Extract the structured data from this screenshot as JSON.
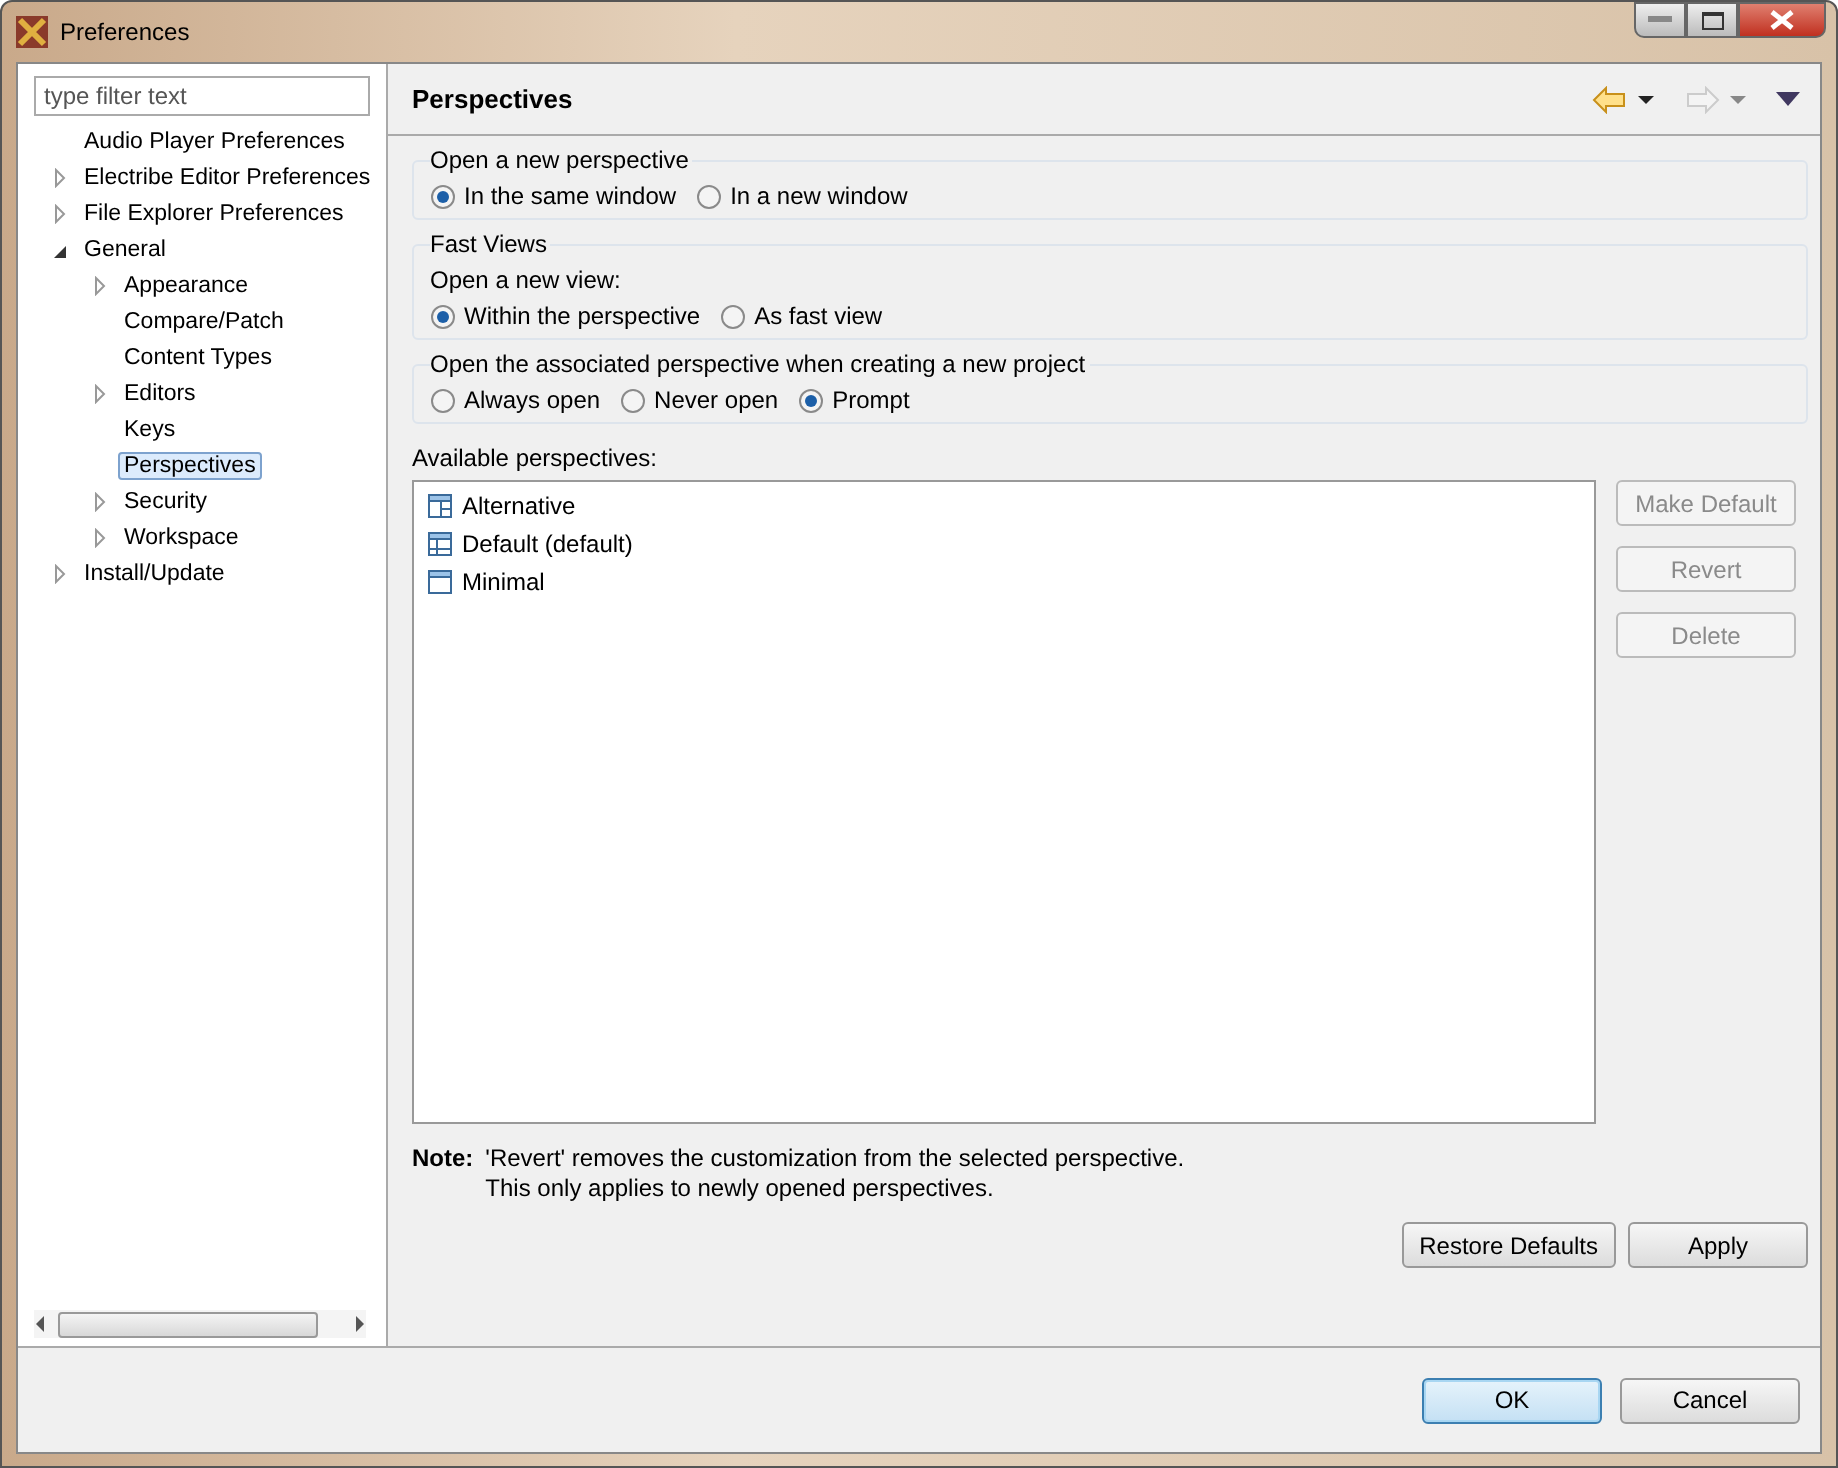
{
  "window": {
    "title": "Preferences"
  },
  "filter": {
    "placeholder": "type filter text"
  },
  "tree": [
    {
      "label": "Audio Player Preferences",
      "kind": "leaf",
      "selected": false
    },
    {
      "label": "Electribe Editor Preferences",
      "kind": "branch",
      "expanded": false,
      "selected": false
    },
    {
      "label": "File Explorer Preferences",
      "kind": "branch",
      "expanded": false,
      "selected": false
    },
    {
      "label": "General",
      "kind": "branch",
      "expanded": true,
      "selected": false,
      "children": [
        {
          "label": "Appearance",
          "kind": "branch",
          "expanded": false,
          "selected": false
        },
        {
          "label": "Compare/Patch",
          "kind": "leaf",
          "selected": false
        },
        {
          "label": "Content Types",
          "kind": "leaf",
          "selected": false
        },
        {
          "label": "Editors",
          "kind": "branch",
          "expanded": false,
          "selected": false
        },
        {
          "label": "Keys",
          "kind": "leaf",
          "selected": false
        },
        {
          "label": "Perspectives",
          "kind": "leaf",
          "selected": true
        },
        {
          "label": "Security",
          "kind": "branch",
          "expanded": false,
          "selected": false
        },
        {
          "label": "Workspace",
          "kind": "branch",
          "expanded": false,
          "selected": false
        }
      ]
    },
    {
      "label": "Install/Update",
      "kind": "branch",
      "expanded": false,
      "selected": false
    }
  ],
  "page": {
    "title": "Perspectives",
    "nav": {
      "back_disabled": false,
      "forward_disabled": true
    },
    "groups": [
      {
        "title": "Open a new perspective",
        "options": [
          {
            "label": "In the same window",
            "selected": true
          },
          {
            "label": "In a new window",
            "selected": false
          }
        ]
      },
      {
        "title": "Fast Views",
        "subtitle": "Open a new view:",
        "options": [
          {
            "label": "Within the perspective",
            "selected": true
          },
          {
            "label": "As fast view",
            "selected": false
          }
        ]
      },
      {
        "title": "Open the associated perspective when creating a new project",
        "options": [
          {
            "label": "Always open",
            "selected": false
          },
          {
            "label": "Never open",
            "selected": false
          },
          {
            "label": "Prompt",
            "selected": true
          }
        ]
      }
    ],
    "list_label": "Available perspectives:",
    "perspectives": [
      {
        "label": "Alternative",
        "kind": "split",
        "selected": false
      },
      {
        "label": "Default (default)",
        "kind": "grid",
        "selected": false
      },
      {
        "label": "Minimal",
        "kind": "plain",
        "selected": false
      }
    ],
    "side_buttons": [
      {
        "label": "Make Default",
        "disabled": true
      },
      {
        "label": "Revert",
        "disabled": true
      },
      {
        "label": "Delete",
        "disabled": true
      }
    ],
    "note_label": "Note:",
    "note_lines": [
      "'Revert' removes the customization from the selected perspective.",
      "This only applies to newly opened perspectives."
    ],
    "page_buttons": [
      "Restore Defaults",
      "Apply"
    ]
  },
  "dialog_buttons": [
    {
      "label": "OK",
      "default": true
    },
    {
      "label": "Cancel",
      "default": false
    }
  ]
}
